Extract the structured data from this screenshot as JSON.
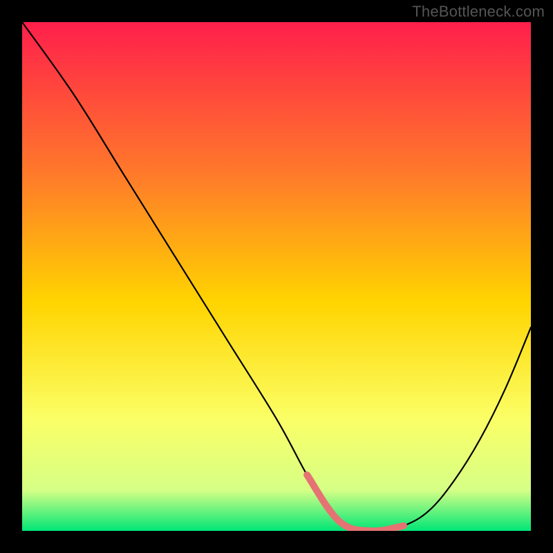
{
  "attribution": "TheBottleneck.com",
  "colors": {
    "gradient_top": "#ff1f4b",
    "gradient_mid1": "#ff7a2a",
    "gradient_mid2": "#ffd400",
    "gradient_mid3": "#fbff66",
    "gradient_mid4": "#d6ff86",
    "gradient_bottom": "#00e676",
    "curve": "#000000",
    "highlight": "#e57373",
    "background": "#000000"
  },
  "chart_data": {
    "type": "line",
    "title": "",
    "xlabel": "",
    "ylabel": "",
    "xlim": [
      0,
      100
    ],
    "ylim": [
      0,
      100
    ],
    "grid": false,
    "legend": false,
    "series": [
      {
        "name": "bottleneck-curve",
        "x": [
          0,
          10,
          20,
          30,
          40,
          50,
          56,
          60,
          63,
          66,
          70,
          75,
          80,
          85,
          90,
          95,
          100
        ],
        "values": [
          100,
          86,
          70,
          54,
          38,
          22,
          11,
          5,
          1,
          0,
          0,
          1,
          4,
          10,
          18,
          28,
          40
        ]
      }
    ],
    "annotations": [
      {
        "name": "highlight-band",
        "type": "segment",
        "x": [
          56,
          75
        ],
        "y": [
          11,
          1
        ],
        "color": "#e57373"
      }
    ]
  }
}
